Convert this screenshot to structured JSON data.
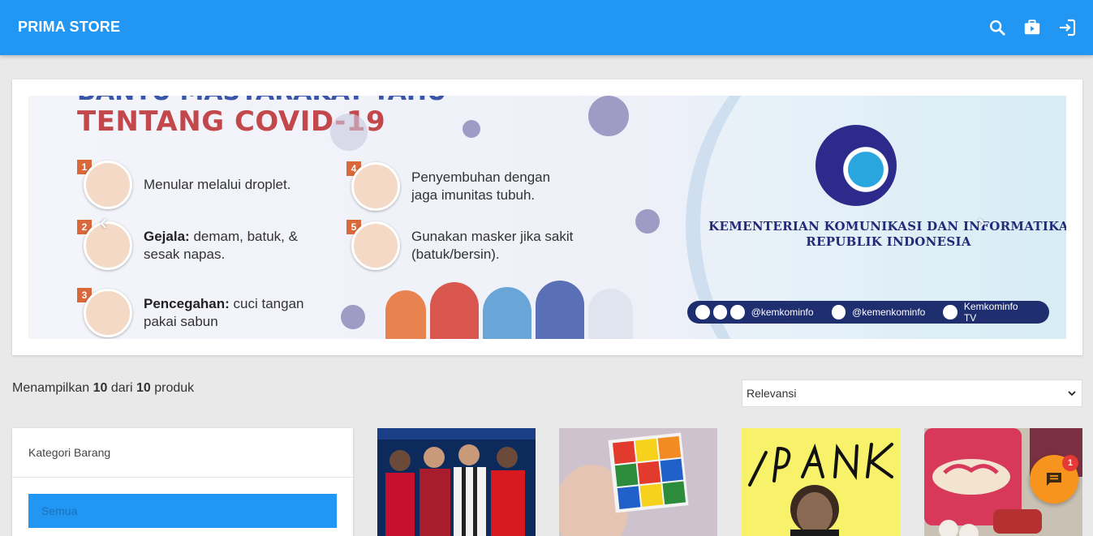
{
  "header": {
    "brand": "PRIMA STORE",
    "icons": [
      "search-icon",
      "briefcase-icon",
      "login-icon"
    ]
  },
  "banner": {
    "title_top": "BANTU MASYARAKAT TAHU",
    "title": "TENTANG COVID-19",
    "items": [
      {
        "num": "1",
        "text_bold": "",
        "text": "Menular melalui droplet."
      },
      {
        "num": "2",
        "text_bold": "Gejala:",
        "text": "demam, batuk, & sesak napas."
      },
      {
        "num": "3",
        "text_bold": "Pencegahan:",
        "text": "cuci tangan pakai sabun"
      },
      {
        "num": "4",
        "text_bold": "",
        "text": "Penyembuhan dengan jaga imunitas tubuh."
      },
      {
        "num": "5",
        "text_bold": "",
        "text": "Gunakan masker jika sakit (batuk/bersin)."
      }
    ],
    "ministry_line1": "KEMENTERIAN KOMUNIKASI DAN INFORMATIKA",
    "ministry_line2": "REPUBLIK INDONESIA",
    "socials": [
      {
        "label": "@kemkominfo"
      },
      {
        "label": "@kemenkominfo"
      },
      {
        "label": "Kemkominfo TV"
      }
    ],
    "prev_arrow": "‹",
    "next_arrow": "›"
  },
  "listing": {
    "count_prefix": "Menampilkan",
    "count_shown": "10",
    "count_mid": "dari",
    "count_total": "10",
    "count_suffix": "produk",
    "sort_value": "Relevansi"
  },
  "category": {
    "title": "Kategori Barang",
    "items": [
      "Semua"
    ]
  },
  "chat": {
    "badge": "1"
  },
  "colors": {
    "primary": "#2196f3",
    "accent": "#f7941e",
    "badge": "#e53935"
  }
}
